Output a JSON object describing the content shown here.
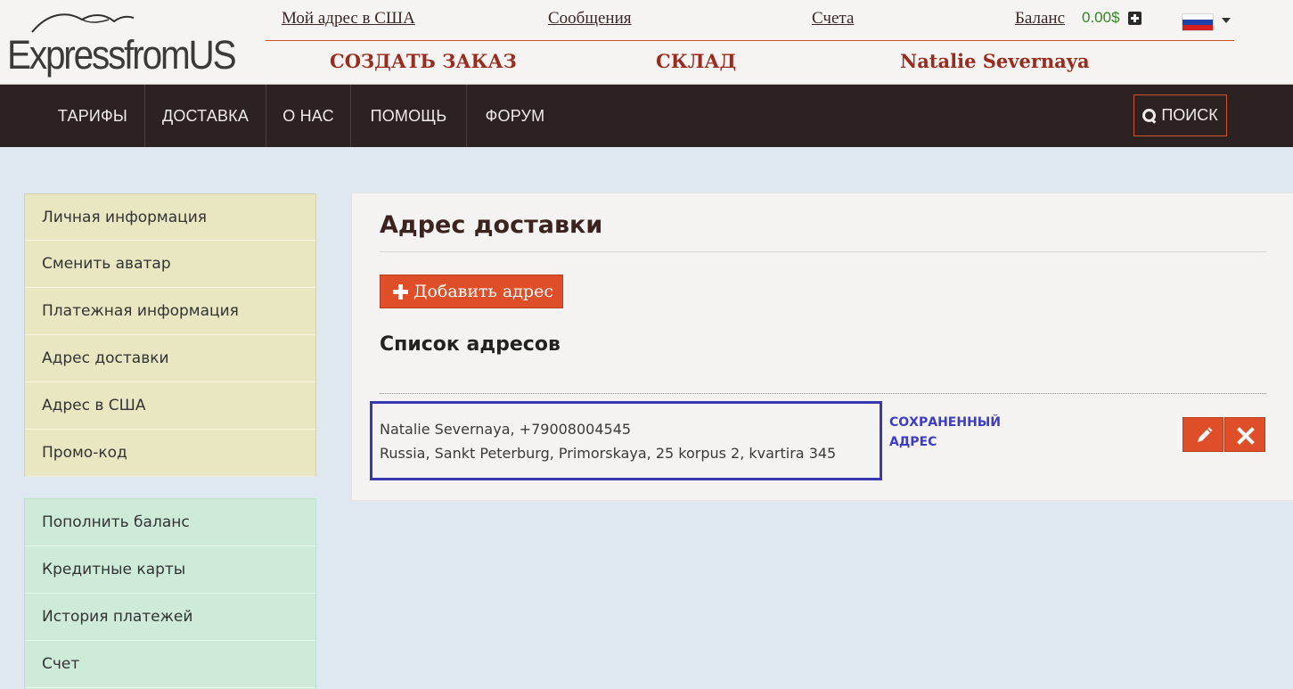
{
  "logo": {
    "text": "ExpressfromUS"
  },
  "top_links": {
    "my_address": "Мой адрес в США",
    "messages": "Сообщения",
    "invoices": "Счета",
    "balance_label": "Баланс",
    "balance_value": "0.00$"
  },
  "big_links": {
    "create_order": "СОЗДАТЬ ЗАКАЗ",
    "warehouse": "СКЛАД",
    "user_name": "Natalie Severnaya"
  },
  "nav": {
    "items": [
      "ТАРИФЫ",
      "ДОСТАВКА",
      "О НАС",
      "ПОМОЩЬ",
      "ФОРУМ"
    ],
    "search_label": "ПОИСК"
  },
  "sidebar": {
    "profile_items": [
      "Личная информация",
      "Сменить аватар",
      "Платежная информация",
      "Адрес доставки",
      "Адрес в США",
      "Промо-код"
    ],
    "finance_items": [
      "Пополнить баланс",
      "Кредитные карты",
      "История платежей",
      "Счет"
    ]
  },
  "main": {
    "title": "Адрес доставки",
    "add_button": "Добавить адрес",
    "list_title": "Список адресов",
    "addresses": [
      {
        "name_phone": "Natalie Severnaya, +79008004545",
        "address": "Russia, Sankt Peterburg, Primorskaya, 25 korpus 2, kvartira 345",
        "status": "СОХРАНЕННЫЙ АДРЕС"
      }
    ]
  },
  "colors": {
    "brand_dark": "#2c2221",
    "accent_orange": "#dd4e29",
    "title_red": "#9a2c1f",
    "balance_green": "#2f8a1f",
    "highlight_blue": "#3838b0",
    "sidebar_yellow": "#e9e6c2",
    "sidebar_green": "#cdebd8"
  },
  "icons": {
    "add": "plus-icon",
    "search": "search-icon",
    "edit": "pencil-icon",
    "delete": "close-icon",
    "balance_add": "plus-square-icon",
    "language": "russia-flag-icon"
  }
}
